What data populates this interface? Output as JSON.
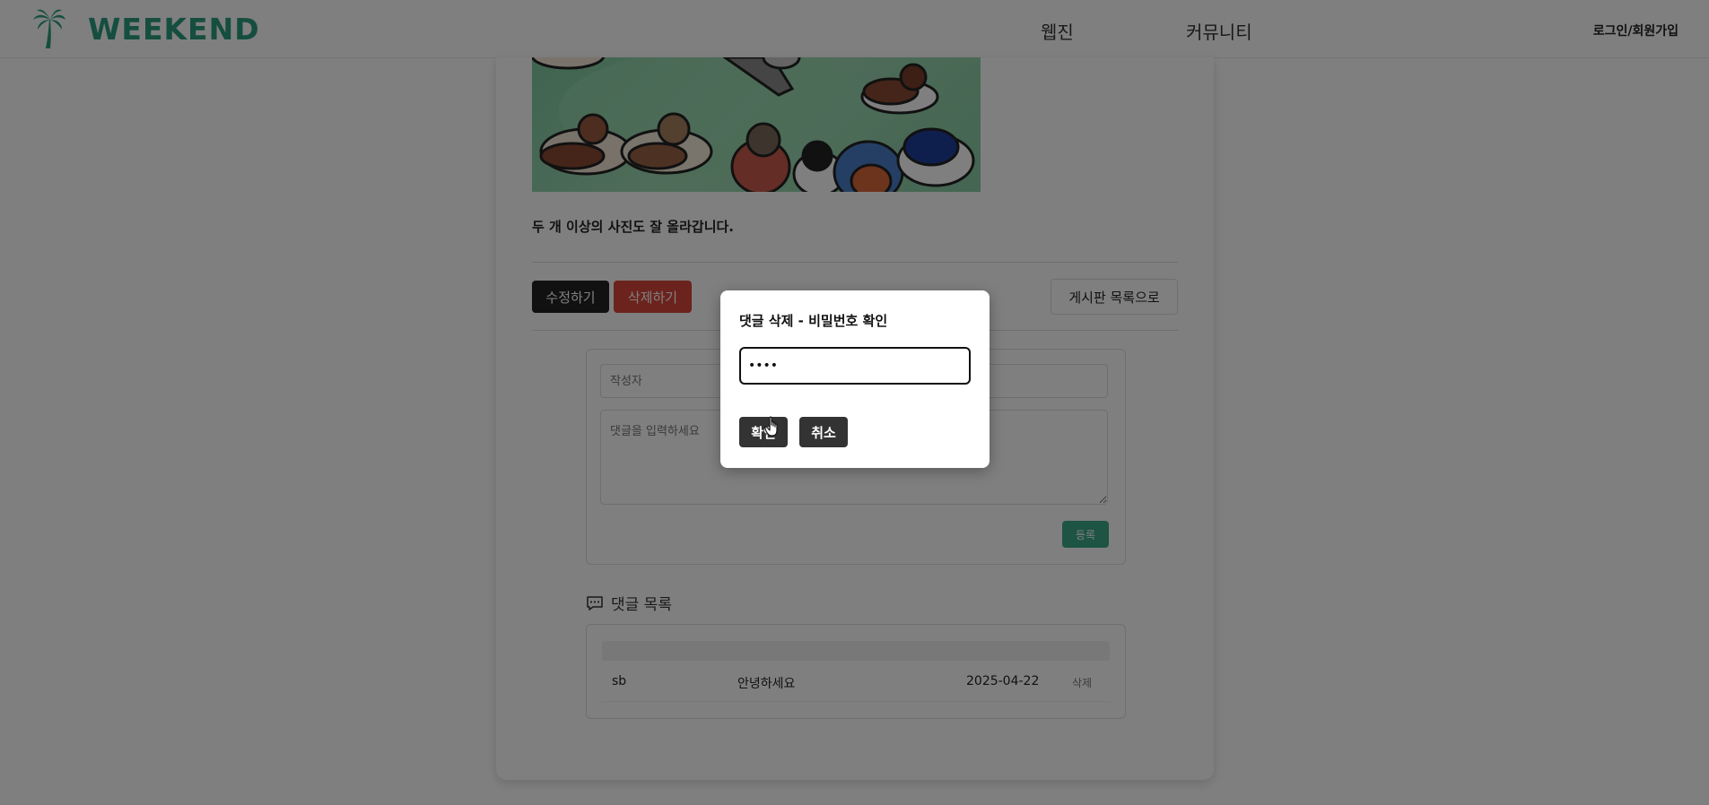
{
  "header": {
    "logo_text": "WEEKEND",
    "nav": [
      "웹진",
      "커뮤니티"
    ],
    "login_label": "로그인/회원가입"
  },
  "post": {
    "text": "두 개 이상의 사진도 잘 올라갑니다.",
    "edit_label": "수정하기",
    "delete_label": "삭제하기",
    "list_label": "게시판 목록으로"
  },
  "comment_form": {
    "author_placeholder": "작성자",
    "content_placeholder": "댓글을 입력하세요",
    "submit_label": "등록"
  },
  "comments": {
    "title": "댓글 목록",
    "rows": [
      {
        "author": "sb",
        "text": "안녕하세요",
        "date": "2025-04-22",
        "delete_label": "삭제"
      }
    ]
  },
  "modal": {
    "title": "댓글 삭제 - 비밀번호 확인",
    "password_value": "1234",
    "confirm_label": "확인",
    "cancel_label": "취소"
  },
  "colors": {
    "brand": "#2a9d7e",
    "delete": "#d9473a",
    "submit": "#3aa889",
    "dark_button": "#333333"
  }
}
